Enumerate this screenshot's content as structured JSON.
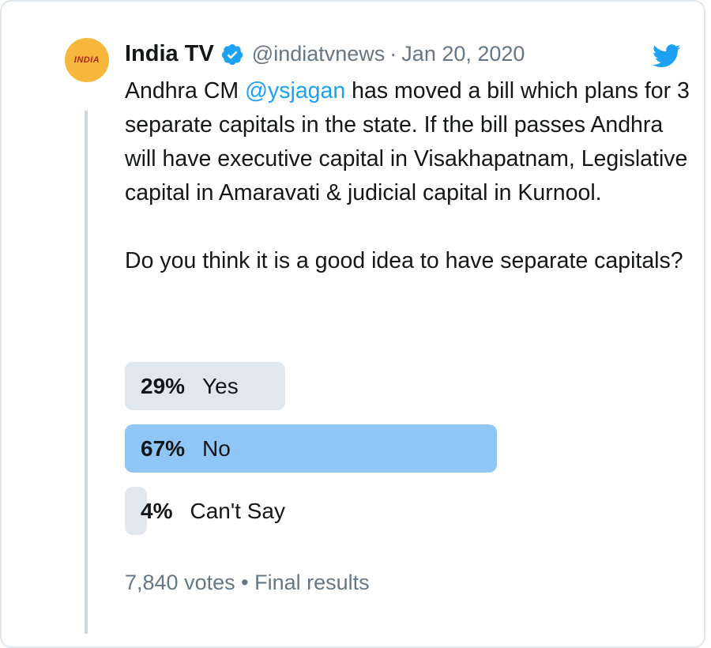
{
  "tweet": {
    "author_name": "India TV",
    "handle": "@indiatvnews",
    "separator": "·",
    "date": "Jan 20, 2020",
    "avatar_text": "INDIA",
    "body_before_mention": "Andhra CM ",
    "mention": "@ysjagan",
    "body_after_mention": " has moved a bill which plans for 3 separate capitals in the state. If the bill passes Andhra will have executive capital in Visakhapatnam, Legislative capital in Amaravati & judicial capital in Kurnool.",
    "question": "Do you think it is a good idea to have separate capitals?"
  },
  "poll": {
    "options": [
      {
        "percent_label": "29%",
        "label": "Yes",
        "percent": 29,
        "winner": false
      },
      {
        "percent_label": "67%",
        "label": "No",
        "percent": 67,
        "winner": true
      },
      {
        "percent_label": "4%",
        "label": "Can't Say",
        "percent": 4,
        "winner": false
      }
    ],
    "votes": "7,840 votes",
    "footer_separator": "•",
    "status": "Final results"
  },
  "icons": {
    "verified": "verified-badge-icon",
    "brand": "twitter-bird-icon"
  },
  "colors": {
    "accent": "#1da1f2",
    "winner_bar": "#8fc6f5",
    "bar": "#e1e8ed",
    "muted_text": "#657786",
    "avatar_bg": "#f6b73c"
  }
}
